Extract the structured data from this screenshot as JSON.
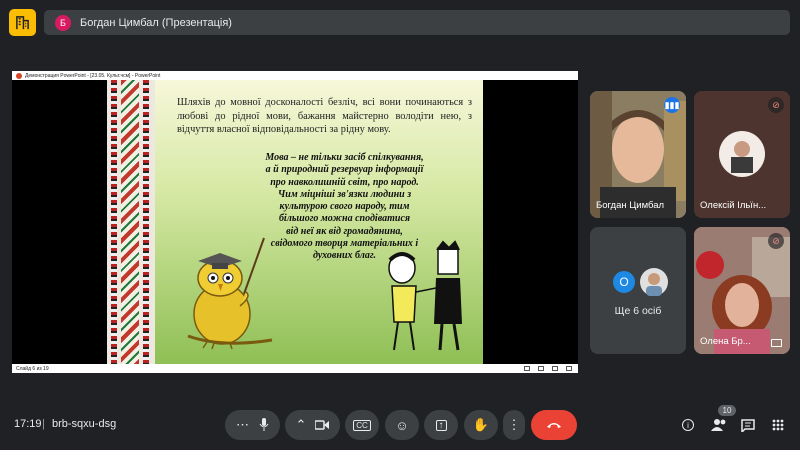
{
  "topbar": {
    "avatar_letter": "Б",
    "title": "Богдан Цимбал (Презентація)"
  },
  "presentation": {
    "window_title": "Демонстрация PowerPoint - [23.05. Культ.чсм] - PowerPoint",
    "status": "Слайд 6 из 19",
    "slide_para1": "Шляхів до мовної досконалості безліч, всі вони починаються з любові до рідної мови, бажання майстерно володіти нею, з відчуття власної відповідальності за рідну мову.",
    "slide_para2": "Мова – не тільки засіб спілкування,\nа й природний резервуар інформації\nпро навколишній світ, про народ.\nЧим міцніші зв'язки людини з\nкультурою свого народу, тим\nбільшого можна сподіватися\nвід неї як від громадянина,\nсвідомого творця матеріальних і\nдуховних благ."
  },
  "participants": [
    {
      "name": "Богдан Цимбал",
      "mic": "speaking"
    },
    {
      "name": "Олексій Ільїн...",
      "mic": "muted"
    },
    {
      "name": "Ще 6 осіб",
      "avatar_letter": "О"
    },
    {
      "name": "Олена Бр...",
      "mic": "muted"
    }
  ],
  "bottombar": {
    "time": "17:19",
    "divider": "|",
    "meeting_code": "brb-sqxu-dsg",
    "people_count": "10"
  },
  "colors": {
    "accent": "#8ab4f8",
    "end_call": "#ea4335",
    "logo": "#fbbc04"
  }
}
